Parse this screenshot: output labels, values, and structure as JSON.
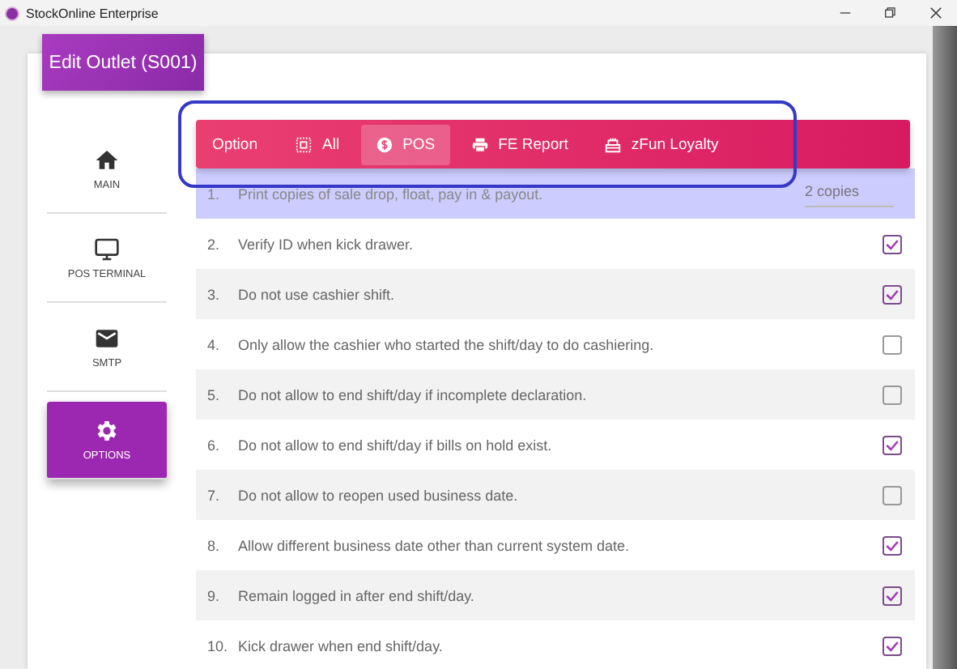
{
  "window": {
    "title": "StockOnline Enterprise"
  },
  "header": {
    "title": "Edit Outlet (S001)"
  },
  "sidebar": {
    "items": [
      {
        "label": "MAIN",
        "selected": false
      },
      {
        "label": "POS TERMINAL",
        "selected": false
      },
      {
        "label": "SMTP",
        "selected": false
      },
      {
        "label": "OPTIONS",
        "selected": true
      }
    ]
  },
  "toolbar": {
    "label": "Option",
    "tabs": [
      {
        "label": "All",
        "selected": false
      },
      {
        "label": "POS",
        "selected": true
      },
      {
        "label": "FE Report",
        "selected": false
      },
      {
        "label": "zFun Loyalty",
        "selected": false
      }
    ]
  },
  "options": [
    {
      "number": "1.",
      "text": "Print copies of sale drop, float, pay in & payout.",
      "kind": "value",
      "value": "2 copies",
      "selected": true
    },
    {
      "number": "2.",
      "text": "Verify ID when kick drawer.",
      "kind": "checkbox",
      "checked": true,
      "selected": false
    },
    {
      "number": "3.",
      "text": "Do not use cashier shift.",
      "kind": "checkbox",
      "checked": true,
      "selected": false
    },
    {
      "number": "4.",
      "text": "Only allow the cashier who started the shift/day to do cashiering.",
      "kind": "checkbox",
      "checked": false,
      "selected": false
    },
    {
      "number": "5.",
      "text": "Do not allow to end shift/day if incomplete declaration.",
      "kind": "checkbox",
      "checked": false,
      "selected": false
    },
    {
      "number": "6.",
      "text": "Do not allow to end shift/day if bills on hold exist.",
      "kind": "checkbox",
      "checked": true,
      "selected": false
    },
    {
      "number": "7.",
      "text": "Do not allow to reopen used business date.",
      "kind": "checkbox",
      "checked": false,
      "selected": false
    },
    {
      "number": "8.",
      "text": "Allow different business date other than current system date.",
      "kind": "checkbox",
      "checked": true,
      "selected": false
    },
    {
      "number": "9.",
      "text": "Remain logged in after end shift/day.",
      "kind": "checkbox",
      "checked": true,
      "selected": false
    },
    {
      "number": "10.",
      "text": "Kick drawer when end shift/day.",
      "kind": "checkbox",
      "checked": true,
      "selected": false
    }
  ]
}
